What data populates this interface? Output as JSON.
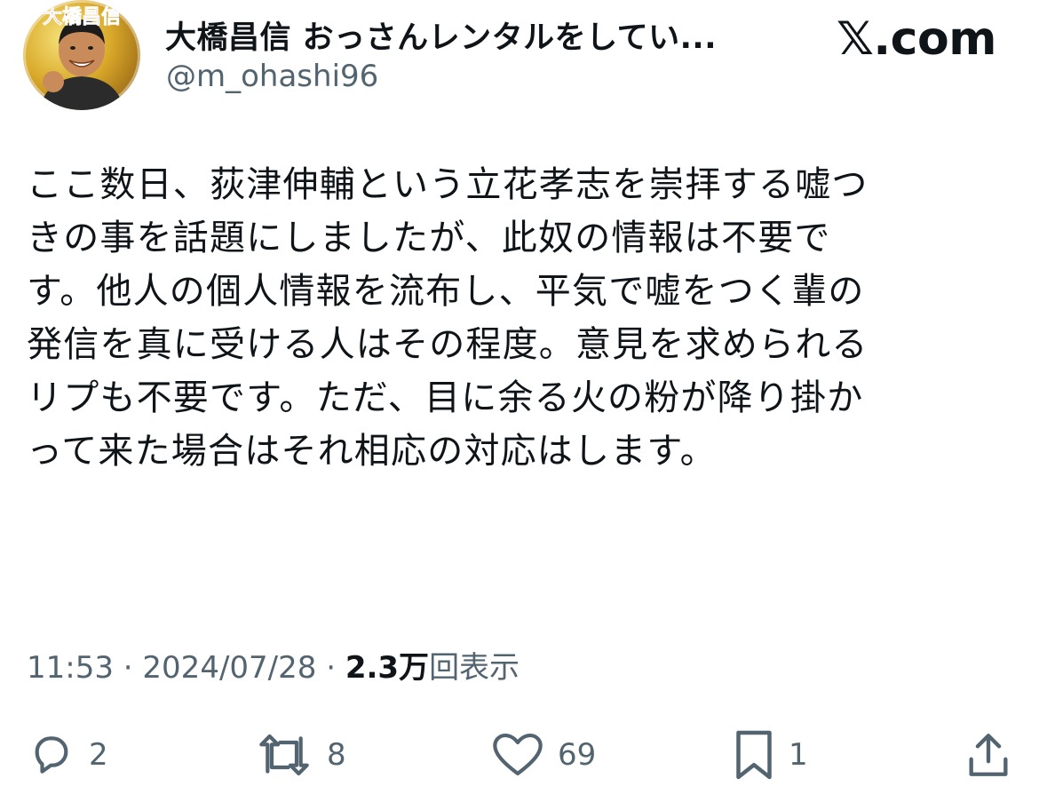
{
  "post": {
    "display_name": "大橋昌信 おっさんレンタルをしてい...",
    "handle": "@m_ohashi96",
    "site": "𝕏.com",
    "avatar_caption": "大橋昌信",
    "text": "ここ数日、荻津伸輔という立花孝志を崇拝する嘘つ\nきの事を話題にしましたが、此奴の情報は不要で\nす。他人の個人情報を流布し、平気で嘘をつく輩の\n発信を真に受ける人はその程度。意見を求められる\nリプも不要です。ただ、目に余る火の粉が降り掛か\nって来た場合はそれ相応の対応はします。",
    "time": "11:53",
    "date": "2024/07/28",
    "separator": "·",
    "views_count": "2.3万",
    "views_label": "回表示"
  },
  "actions": {
    "reply_count": "2",
    "repost_count": "8",
    "like_count": "69",
    "bookmark_count": "1"
  },
  "colors": {
    "text": "#0f1419",
    "secondary": "#536471",
    "background": "#ffffff"
  },
  "icons": [
    "reply-icon",
    "repost-icon",
    "like-icon",
    "bookmark-icon",
    "share-icon",
    "x-logo"
  ]
}
